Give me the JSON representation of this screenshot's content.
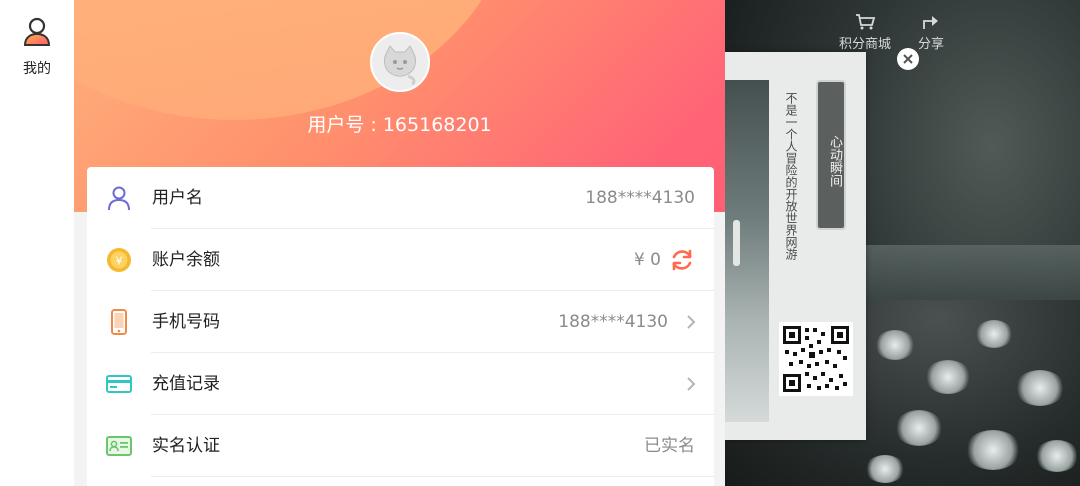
{
  "rail": {
    "profile_label": "我的",
    "icon": "user-icon"
  },
  "account": {
    "user_id_text": "用户号 : 165168201",
    "rows": [
      {
        "label": "用户名",
        "value": "188****4130",
        "icon": "user-outline-icon",
        "color": "#6d6cd6"
      },
      {
        "label": "账户余额",
        "value": "¥ 0",
        "icon": "coin-icon",
        "color": "#f5b82e"
      },
      {
        "label": "手机号码",
        "value": "188****4130",
        "icon": "phone-icon",
        "color": "#f08a4a"
      },
      {
        "label": "充值记录",
        "value": "",
        "icon": "card-icon",
        "color": "#2fc7c5"
      },
      {
        "label": "实名认证",
        "value": "已实名",
        "icon": "id-card-icon",
        "color": "#69c66a"
      }
    ],
    "accent": "#ff6576",
    "refresh_color": "#ff6a4c"
  },
  "game": {
    "shop_label": "积分商城",
    "share_label": "分享",
    "scroll_title": "心动瞬间",
    "scroll_text": "不是一个人冒险的开放世界网游"
  }
}
